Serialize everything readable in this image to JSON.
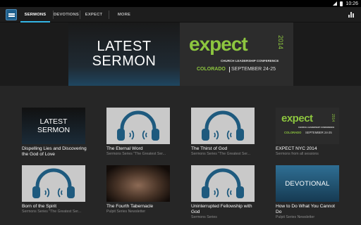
{
  "status_bar": {
    "time": "10:26"
  },
  "tabs": [
    {
      "label": "SERMONS",
      "active": true
    },
    {
      "label": "DEVOTIONS",
      "active": false
    },
    {
      "label": "EXPECT",
      "active": false
    },
    {
      "label": "MORE",
      "active": false
    }
  ],
  "banner": {
    "left_line1": "LATEST",
    "left_line2": "SERMON",
    "expect_word": "expect",
    "expect_year": "2014",
    "expect_sub": "CHURCH LEADERSHIP CONFERENCE",
    "expect_location": "COLORADO",
    "expect_date": "SEPTEMBER 24-25"
  },
  "cards": [
    {
      "title": "Dispelling Lies and Discovering the God of Love",
      "subtitle": "",
      "thumb": "latest",
      "thumb_line1": "LATEST",
      "thumb_line2": "SERMON"
    },
    {
      "title": "The Eternal Word",
      "subtitle": "Sermons Series \"The Greatest Ser...",
      "thumb": "headphones"
    },
    {
      "title": "The Thirst of God",
      "subtitle": "Sermons Series \"The Greatest Ser...",
      "thumb": "headphones"
    },
    {
      "title": "EXPECT NYC 2014",
      "subtitle": "Sermons from all sessions",
      "thumb": "expect",
      "thumb_expect_word": "expect",
      "thumb_expect_year": "2014",
      "thumb_expect_sub": "CHURCH LEADERSHIP CONFERENCE",
      "thumb_expect_location": "COLORADO",
      "thumb_expect_date": "SEPTEMBER 24-25"
    },
    {
      "title": "Born of the Spirit",
      "subtitle": "Sermons Series \"The Greatest Ser...",
      "thumb": "headphones"
    },
    {
      "title": "The Fourth Tabernacle",
      "subtitle": "Pulpit Series Newsletter",
      "thumb": "photo"
    },
    {
      "title": "Uninterrupted Fellowship with God",
      "subtitle": "Sermons Series",
      "thumb": "headphones"
    },
    {
      "title": "How to Do What You Cannot Do",
      "subtitle": "Pulpit Series Newsletter",
      "thumb": "devotional",
      "thumb_label": "DEVOTIONAL"
    }
  ],
  "colors": {
    "accent": "#33b5e5",
    "expect_green": "#8dc63f",
    "headphone_blue": "#1e5a7e",
    "thumb_grey": "#c9c9c9"
  },
  "icons": [
    "app-logo-icon",
    "signal-icon",
    "battery-icon",
    "bar-chart-icon",
    "headphones-icon"
  ]
}
